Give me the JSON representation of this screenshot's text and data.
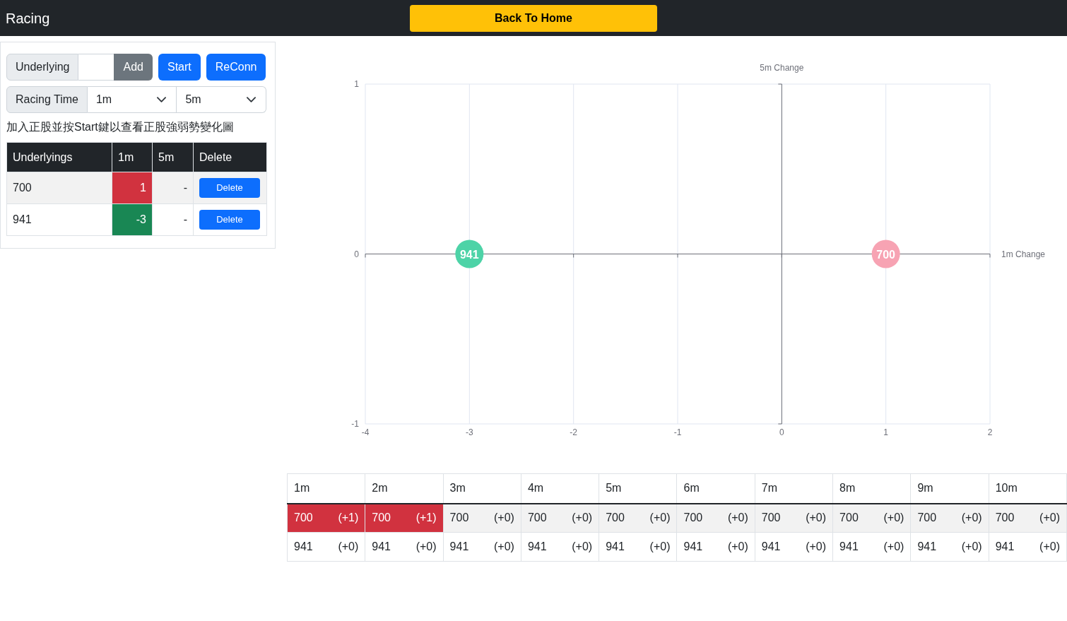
{
  "header": {
    "title": "Racing",
    "home_button": "Back To Home"
  },
  "controls": {
    "underlying_label": "Underlying",
    "add_button": "Add",
    "start_button": "Start",
    "reconn_button": "ReConn"
  },
  "racing_time": {
    "label": "Racing Time",
    "selects": [
      {
        "value": "1m"
      },
      {
        "value": "5m"
      }
    ]
  },
  "hint": "加入正股並按Start鍵以查看正股強弱勢變化圖",
  "underlyings_table": {
    "columns": [
      "Underlyings",
      "1m",
      "5m",
      "Delete"
    ],
    "rows": [
      {
        "underlying": "700",
        "change_1m": {
          "value": "1",
          "color": "#d1323f"
        },
        "change_5m": {
          "value": "-"
        },
        "delete_button": "Delete"
      },
      {
        "underlying": "941",
        "change_1m": {
          "value": "-3",
          "color": "#198754"
        },
        "change_5m": {
          "value": "-"
        },
        "delete_button": "Delete"
      }
    ]
  },
  "chart": {
    "chart_data": {
      "type": "scatter",
      "xlabel": "1m Change",
      "ylabel": "5m Change",
      "x": [
        -3,
        1
      ],
      "series": [
        {
          "name": "941",
          "color": "#4dd3a7",
          "values": [
            0,
            null
          ]
        },
        {
          "name": "700",
          "color": "#f7a3b3",
          "values": [
            null,
            0
          ]
        }
      ],
      "xlim": [
        -4,
        2
      ],
      "ylim": [
        -1,
        1
      ],
      "xticks": [
        -4,
        -3,
        -2,
        -1,
        0,
        1,
        2
      ],
      "yticks": [
        -1,
        0,
        1
      ],
      "grid": true
    }
  },
  "timeline_table": {
    "columns": [
      "1m",
      "2m",
      "3m",
      "4m",
      "5m",
      "6m",
      "7m",
      "8m",
      "9m",
      "10m"
    ],
    "rows": [
      [
        {
          "code": "700",
          "change": "(+1)",
          "color": "#d1323f"
        },
        {
          "code": "700",
          "change": "(+1)",
          "color": "#d1323f"
        },
        {
          "code": "700",
          "change": "(+0)"
        },
        {
          "code": "700",
          "change": "(+0)"
        },
        {
          "code": "700",
          "change": "(+0)"
        },
        {
          "code": "700",
          "change": "(+0)"
        },
        {
          "code": "700",
          "change": "(+0)"
        },
        {
          "code": "700",
          "change": "(+0)"
        },
        {
          "code": "700",
          "change": "(+0)"
        },
        {
          "code": "700",
          "change": "(+0)"
        }
      ],
      [
        {
          "code": "941",
          "change": "(+0)"
        },
        {
          "code": "941",
          "change": "(+0)"
        },
        {
          "code": "941",
          "change": "(+0)"
        },
        {
          "code": "941",
          "change": "(+0)"
        },
        {
          "code": "941",
          "change": "(+0)"
        },
        {
          "code": "941",
          "change": "(+0)"
        },
        {
          "code": "941",
          "change": "(+0)"
        },
        {
          "code": "941",
          "change": "(+0)"
        },
        {
          "code": "941",
          "change": "(+0)"
        },
        {
          "code": "941",
          "change": "(+0)"
        }
      ]
    ]
  }
}
